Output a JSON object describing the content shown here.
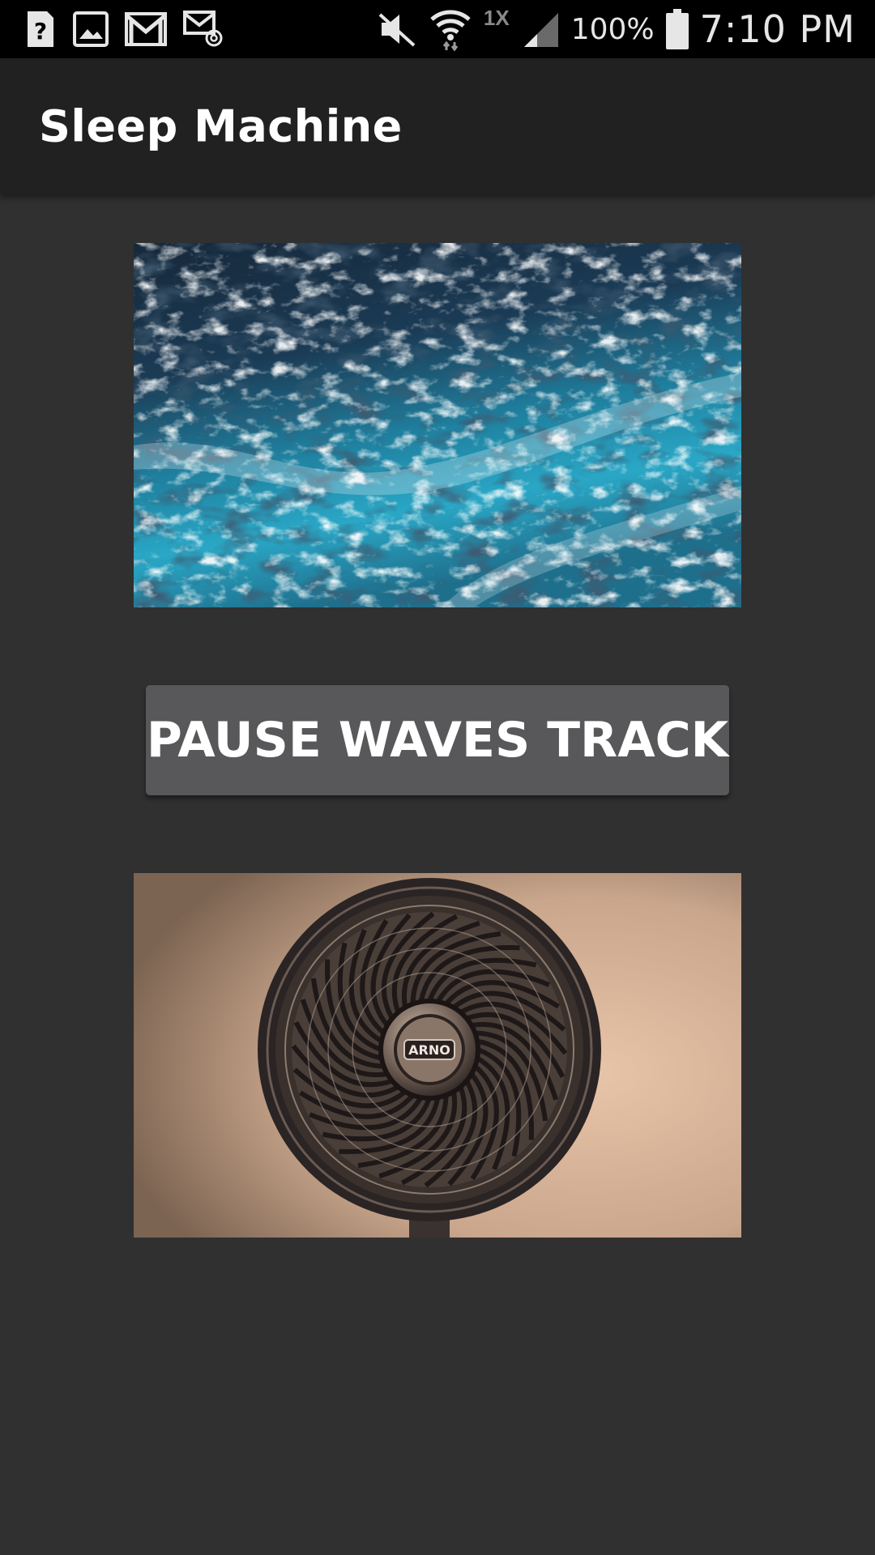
{
  "status_bar": {
    "left_icons": [
      "help-icon",
      "image-icon",
      "gmail-icon",
      "email-at-icon"
    ],
    "right_icons": [
      "vibrate-icon",
      "wifi-icon",
      "cellular-signal-icon",
      "battery-icon"
    ],
    "network_badge": "1X",
    "battery_text": "100%",
    "time": "7:10 PM"
  },
  "app_bar": {
    "title": "Sleep Machine"
  },
  "main": {
    "waves_image": {
      "name": "waves-image",
      "description_icon": "ocean-waves-image"
    },
    "pause_button_label": "PAUSE WAVES TRACK",
    "fan_image": {
      "name": "fan-image",
      "brand_text": "ARNO"
    }
  },
  "colors": {
    "background": "#303030",
    "app_bar": "#212121",
    "status_bar": "#000000",
    "button": "#58585a",
    "text": "#ffffff"
  }
}
